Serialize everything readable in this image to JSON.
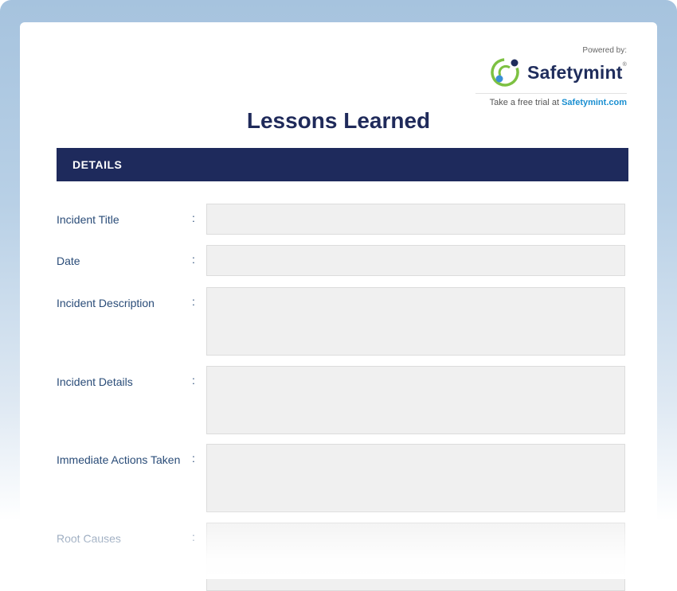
{
  "brand": {
    "powered_by": "Powered by:",
    "name": "Safetymint",
    "registered": "®",
    "trial_prefix": "Take a free trial at ",
    "trial_link": "Safetymint.com",
    "colors": {
      "ring": "#7dc142",
      "dot_dark": "#1f2d5c",
      "dot_light": "#3a8fd6",
      "link": "#1a8fd1"
    }
  },
  "document": {
    "title": "Lessons Learned",
    "section": "DETAILS",
    "fields": [
      {
        "label": "Incident Title",
        "separator": ":",
        "value": ""
      },
      {
        "label": "Date",
        "separator": ":",
        "value": ""
      },
      {
        "label": "Incident Description",
        "separator": ":",
        "value": ""
      },
      {
        "label": "Incident Details",
        "separator": ":",
        "value": ""
      },
      {
        "label": "Immediate Actions Taken",
        "separator": ":",
        "value": ""
      },
      {
        "label": "Root Causes",
        "separator": ":",
        "value": ""
      }
    ]
  },
  "colors": {
    "header_bar": "#1e2a5c",
    "title": "#1f2a5a",
    "label": "#2a4c78",
    "frame": "#a6c3de"
  }
}
